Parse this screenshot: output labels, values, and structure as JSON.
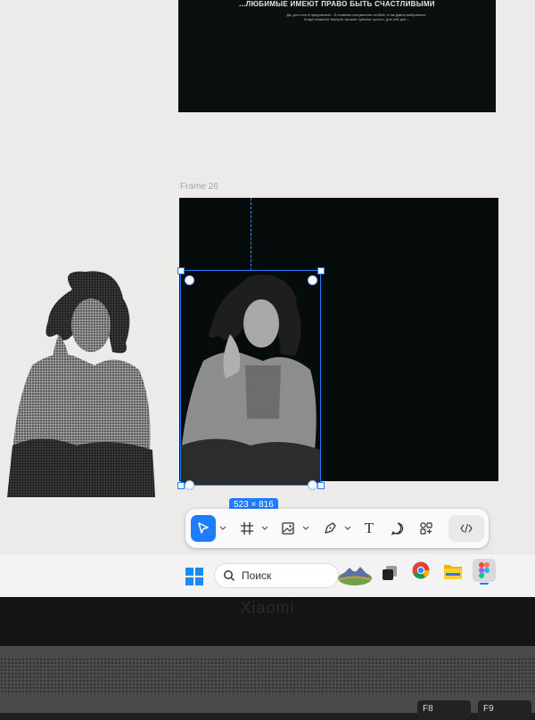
{
  "canvas": {
    "top_frame": {
      "heading": "...ЛЮБИМЫЕ ИМЕЮТ ПРАВО БЫТЬ СЧАСТЛИВЫМИ",
      "body": "Да, для того в предлагаем... В главном специально особой, я так давно выбранные. Когда позволит вернуть лучшие чувства, просто, для неё для..."
    },
    "frame_label": "Frame 26",
    "selection": {
      "dimensions": "523 × 816"
    }
  },
  "toolbar": {
    "tools": [
      {
        "name": "move",
        "icon": "cursor-arrow-icon",
        "active": true
      },
      {
        "name": "frame",
        "icon": "frame-hash-icon",
        "active": false
      },
      {
        "name": "image",
        "icon": "image-icon",
        "active": false
      },
      {
        "name": "pen",
        "icon": "pen-nib-icon",
        "active": false
      },
      {
        "name": "text",
        "icon": "text-t-icon",
        "active": false
      },
      {
        "name": "comment",
        "icon": "comment-bubble-icon",
        "active": false
      },
      {
        "name": "actions",
        "icon": "shapes-plus-icon",
        "active": false
      },
      {
        "name": "dev-mode",
        "icon": "code-brackets-icon",
        "active": false
      }
    ],
    "text_tool_label": "T"
  },
  "taskbar": {
    "search_placeholder": "Поиск",
    "apps": [
      "widgets-icon",
      "task-view-icon",
      "chrome-icon",
      "file-explorer-icon",
      "figma-icon"
    ]
  },
  "device": {
    "brand": "Xiaomi",
    "keys": [
      "F8",
      "F9"
    ]
  },
  "colors": {
    "accent": "#1f7cff",
    "frame_bg": "#060b0c",
    "canvas_bg": "#ecebe9"
  }
}
